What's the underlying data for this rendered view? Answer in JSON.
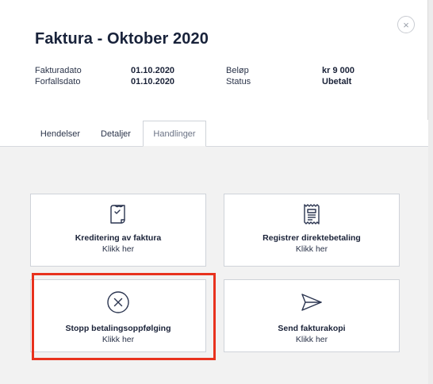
{
  "invoice": {
    "title": "Faktura - Oktober 2020",
    "fields_left": [
      {
        "label": "Fakturadato",
        "value": "01.10.2020"
      },
      {
        "label": "Forfallsdato",
        "value": "01.10.2020"
      }
    ],
    "fields_right": [
      {
        "label": "Beløp",
        "value": "kr 9 000"
      },
      {
        "label": "Status",
        "value": "Ubetalt"
      }
    ]
  },
  "close": {
    "glyph": "×",
    "icon": "close-icon"
  },
  "tabs": [
    {
      "label": "Hendelser"
    },
    {
      "label": "Detaljer"
    },
    {
      "label": "Handlinger",
      "active": true
    }
  ],
  "actions": [
    {
      "label": "Kreditering av faktura",
      "sub": "Klikk her",
      "icon": "receipt-credit-icon"
    },
    {
      "label": "Registrer direktebetaling",
      "sub": "Klikk her",
      "icon": "receipt-list-icon"
    },
    {
      "label": "Stopp betalingsoppfølging",
      "sub": "Klikk her",
      "icon": "circle-x-icon",
      "highlighted": true
    },
    {
      "label": "Send fakturakopi",
      "sub": "Klikk her",
      "icon": "send-plane-icon"
    }
  ],
  "colors": {
    "highlight": "#e8321e",
    "text_dark": "#1a2238",
    "panel_bg": "#f2f2f2"
  }
}
